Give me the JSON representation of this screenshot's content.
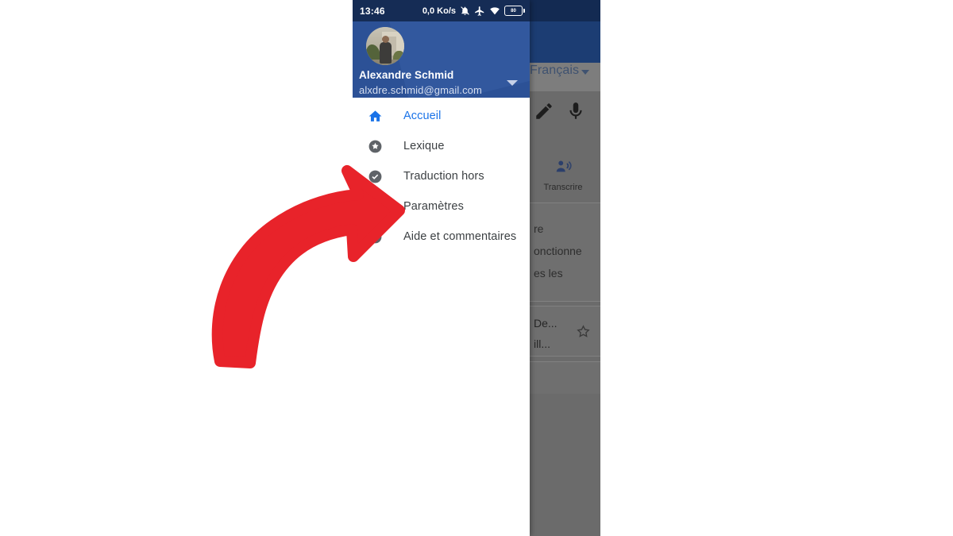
{
  "status_bar": {
    "time": "13:46",
    "data_rate": "0,0 Ko/s",
    "battery_level": "80",
    "icons": [
      "bell-muted-icon",
      "airplane-icon",
      "wifi-icon",
      "battery-icon"
    ]
  },
  "drawer": {
    "account": {
      "name": "Alexandre Schmid",
      "email": "alxdre.schmid@gmail.com",
      "switch_account_icon": "chevron-down-icon",
      "avatar": "user-avatar"
    },
    "items": [
      {
        "label": "Accueil",
        "icon": "home-icon",
        "active": true
      },
      {
        "label": "Lexique",
        "icon": "star-circle-icon",
        "active": false
      },
      {
        "label": "Traduction hors",
        "icon": "check-circle-icon",
        "active": false
      },
      {
        "label": "Paramètres",
        "icon": "gear-icon",
        "active": false
      },
      {
        "label": "Aide et commentaires",
        "icon": "help-circle-icon",
        "active": false
      }
    ]
  },
  "app_behind": {
    "language": "Français",
    "language_caret": "caret-down-icon",
    "handwriting_icon": "pen-icon",
    "mic_icon": "microphone-icon",
    "transcribe": {
      "label": "Transcrire",
      "icon": "person-speaking-icon"
    },
    "cards": [
      {
        "lines": [
          "re",
          "onctionne",
          "es les"
        ]
      },
      {
        "lines": [
          "De...",
          "ill..."
        ],
        "star_icon": "star-outline-icon"
      }
    ]
  },
  "annotation": {
    "arrow": "curved-red-arrow",
    "color": "#E8232A",
    "points_at": "Paramètres"
  },
  "colors": {
    "accent_blue": "#1a73e8",
    "drawer_header": "#2c5196",
    "status_bar": "#152c55",
    "scrim": "#6b6b6b",
    "arrow_red": "#E8232A"
  }
}
